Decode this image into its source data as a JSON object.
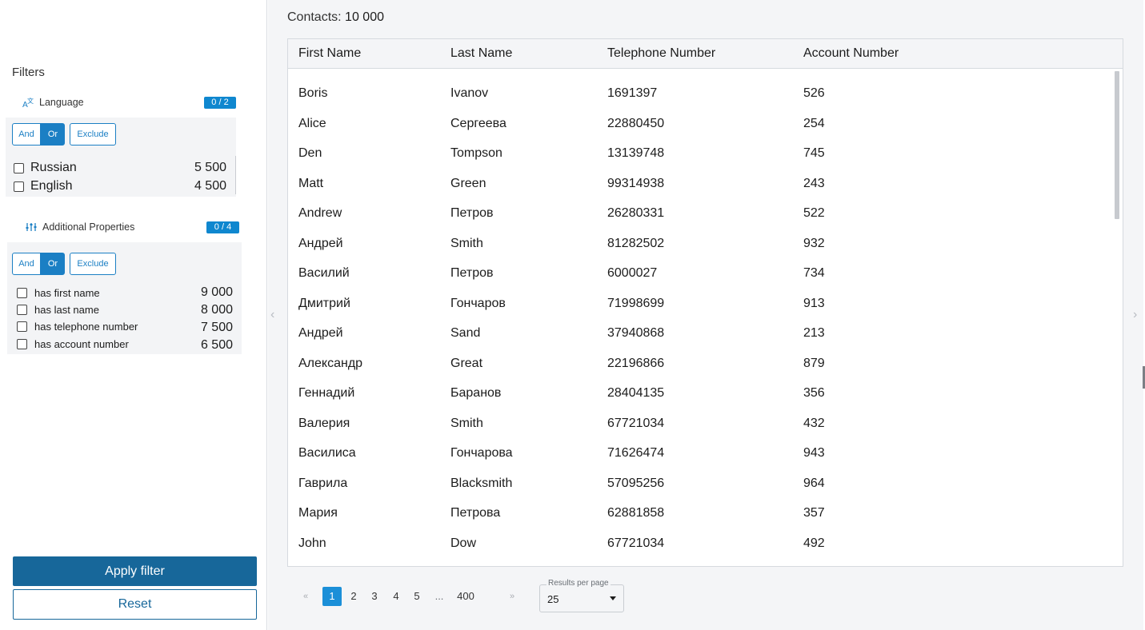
{
  "sidebar": {
    "title": "Filters",
    "language": {
      "label": "Language",
      "badge": "0 / 2",
      "modes": [
        "And",
        "Or",
        "Exclude"
      ],
      "active_mode": "Or",
      "options": [
        {
          "label": "Russian",
          "count": "5 500",
          "checked": false
        },
        {
          "label": "English",
          "count": "4 500",
          "checked": false
        }
      ]
    },
    "properties": {
      "label": "Additional Properties",
      "badge": "0 / 4",
      "modes": [
        "And",
        "Or",
        "Exclude"
      ],
      "active_mode": "Or",
      "options": [
        {
          "label": "has first name",
          "count": "9 000",
          "checked": false
        },
        {
          "label": "has last name",
          "count": "8 000",
          "checked": false
        },
        {
          "label": "has telephone number",
          "count": "7 500",
          "checked": false
        },
        {
          "label": "has account number",
          "count": "6 500",
          "checked": false
        }
      ]
    },
    "apply_label": "Apply filter",
    "reset_label": "Reset"
  },
  "main": {
    "contacts_label": "Contacts:",
    "contacts_count": "10 000",
    "prev_arrow": "‹",
    "next_arrow": "›",
    "table": {
      "columns": [
        "First Name",
        "Last Name",
        "Telephone Number",
        "Account Number"
      ],
      "rows": [
        [
          "Boris",
          "Ivanov",
          "1691397",
          "526"
        ],
        [
          "Alice",
          "Сергеева",
          "22880450",
          "254"
        ],
        [
          "Den",
          "Tompson",
          "13139748",
          "745"
        ],
        [
          "Matt",
          "Green",
          "99314938",
          "243"
        ],
        [
          "Andrew",
          "Петров",
          "26280331",
          "522"
        ],
        [
          "Андрей",
          "Smith",
          "81282502",
          "932"
        ],
        [
          "Василий",
          "Петров",
          "6000027",
          "734"
        ],
        [
          "Дмитрий",
          "Гончаров",
          "71998699",
          "913"
        ],
        [
          "Андрей",
          "Sand",
          "37940868",
          "213"
        ],
        [
          "Александр",
          "Great",
          "22196866",
          "879"
        ],
        [
          "Геннадий",
          "Баранов",
          "28404135",
          "356"
        ],
        [
          "Валерия",
          "Smith",
          "67721034",
          "432"
        ],
        [
          "Василиса",
          "Гончарова",
          "71626474",
          "943"
        ],
        [
          "Гаврила",
          "Blacksmith",
          "57095256",
          "964"
        ],
        [
          "Мария",
          "Петрова",
          "62881858",
          "357"
        ],
        [
          "John",
          "Dow",
          "67721034",
          "492"
        ]
      ]
    },
    "pagination": {
      "first": "«",
      "pages": [
        "1",
        "2",
        "3",
        "4",
        "5"
      ],
      "current": "1",
      "ellipsis": "...",
      "last_page": "400",
      "next": "»",
      "results_per_page_label": "Results per page",
      "results_per_page_value": "25"
    }
  },
  "colors": {
    "accent": "#1b7fc4",
    "badge": "#0f87cf",
    "apply_button": "#17679a",
    "active_page": "#1b8fd8"
  }
}
